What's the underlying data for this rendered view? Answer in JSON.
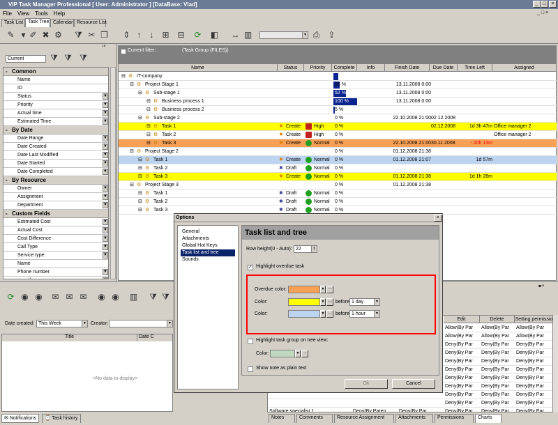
{
  "window": {
    "title": "VIP Task Manager Professional [ User: Administrator ] [DataBase: Vlad]"
  },
  "menu": [
    "File",
    "View",
    "Tools",
    "Help"
  ],
  "tabs": [
    "Task List",
    "Task Tree",
    "Calendar",
    "Resource List"
  ],
  "left_panel": {
    "filter_combo": "Current",
    "groups": [
      {
        "name": "Common",
        "items": [
          "Name",
          "ID",
          "Status",
          "Priority",
          "Actual time",
          "Estimated Time"
        ]
      },
      {
        "name": "By Date",
        "items": [
          "Date Range",
          "Date Created",
          "Date Last Modified",
          "Date Started",
          "Date Completed"
        ]
      },
      {
        "name": "By Resource",
        "items": [
          "Owner",
          "Assignment",
          "Department"
        ]
      },
      {
        "name": "Custom Fields",
        "items": [
          "Estimated Cost",
          "Actual Cost",
          "Cost Difference",
          "Call Type",
          "Service type",
          "Name",
          "Phone number",
          "e-mail"
        ]
      }
    ]
  },
  "filter_bar": {
    "label": "Current filter:",
    "value": "(Task Group  {FILES})"
  },
  "grid": {
    "columns": [
      "Name",
      "Status",
      "Priority",
      "Complete",
      "Info",
      "Finish Date",
      "Due Date",
      "Time Left",
      "Assigned"
    ],
    "rows": [
      {
        "name": "IT-company",
        "level": 0,
        "status": "",
        "priority": "",
        "complete": "",
        "finish": "",
        "due": "",
        "left": "",
        "assigned": "",
        "style": ""
      },
      {
        "name": "Project Stage 1",
        "level": 1,
        "status": "",
        "priority": "",
        "complete": "26 %",
        "finish": "13.11.2008 0:00",
        "due": "",
        "left": "",
        "assigned": "",
        "style": ""
      },
      {
        "name": "Sub-stage 1",
        "level": 2,
        "status": "",
        "priority": "",
        "complete": "52 %",
        "finish": "13.11.2008 0:00",
        "due": "",
        "left": "",
        "assigned": "",
        "style": ""
      },
      {
        "name": "Business process 1",
        "level": 3,
        "status": "",
        "priority": "",
        "complete": "100 %",
        "finish": "13.11.2008 0:00",
        "due": "",
        "left": "",
        "assigned": "",
        "style": ""
      },
      {
        "name": "Business process 2",
        "level": 3,
        "status": "",
        "priority": "",
        "complete": "5 %",
        "finish": "",
        "due": "",
        "left": "",
        "assigned": "",
        "style": ""
      },
      {
        "name": "Sub-stage 2",
        "level": 2,
        "status": "",
        "priority": "",
        "complete": "0 %",
        "finish": "22.10.2008 21:00",
        "due": "02.12.2008",
        "left": "",
        "assigned": "",
        "style": ""
      },
      {
        "name": "Task 1",
        "level": 3,
        "status": "Create",
        "priority": "High",
        "complete": "0 %",
        "finish": "",
        "due": "02.12.2008",
        "left": "1d 3h 47m",
        "assigned": "Office manager 2",
        "style": "yellow"
      },
      {
        "name": "Task 2",
        "level": 3,
        "status": "Create",
        "priority": "High",
        "complete": "0 %",
        "finish": "",
        "due": "",
        "left": "",
        "assigned": "Office manager 2",
        "style": ""
      },
      {
        "name": "Task 3",
        "level": 3,
        "status": "Create",
        "priority": "Normal",
        "complete": "0 %",
        "finish": "22.10.2008 21:00",
        "due": "30.11.2008",
        "left": "- 20h 13m",
        "assigned": "",
        "style": "orange"
      },
      {
        "name": "Project Stage 2",
        "level": 1,
        "status": "",
        "priority": "",
        "complete": "0 %",
        "finish": "01.12.2008 21:38",
        "due": "",
        "left": "",
        "assigned": "",
        "style": ""
      },
      {
        "name": "Task 1",
        "level": 2,
        "status": "Create",
        "priority": "Normal",
        "complete": "0 %",
        "finish": "01.12.2008 21:07",
        "due": "",
        "left": "1d 57m",
        "assigned": "",
        "style": "blue"
      },
      {
        "name": "Task 2",
        "level": 2,
        "status": "Draft",
        "priority": "Normal",
        "complete": "0 %",
        "finish": "",
        "due": "",
        "left": "",
        "assigned": "",
        "style": ""
      },
      {
        "name": "Task 3",
        "level": 2,
        "status": "Create",
        "priority": "Normal",
        "complete": "0 %",
        "finish": "01.12.2008 21:38",
        "due": "",
        "left": "1d 1h 28m",
        "assigned": "",
        "style": "yellow"
      },
      {
        "name": "Project Stage 3",
        "level": 1,
        "status": "",
        "priority": "",
        "complete": "0 %",
        "finish": "01.12.2008 21:38",
        "due": "",
        "left": "",
        "assigned": "",
        "style": ""
      },
      {
        "name": "Task 1",
        "level": 2,
        "status": "Draft",
        "priority": "Normal",
        "complete": "0 %",
        "finish": "",
        "due": "",
        "left": "",
        "assigned": "",
        "style": ""
      },
      {
        "name": "Task 2",
        "level": 2,
        "status": "Draft",
        "priority": "Normal",
        "complete": "0 %",
        "finish": "",
        "due": "",
        "left": "",
        "assigned": "",
        "style": ""
      },
      {
        "name": "Task 3",
        "level": 2,
        "status": "Draft",
        "priority": "Normal",
        "complete": "0 %",
        "finish": "",
        "due": "",
        "left": "",
        "assigned": "",
        "style": ""
      }
    ]
  },
  "completion_bars": [
    {
      "row": 0,
      "value": 0.2,
      "label": "20 %"
    },
    {
      "row": 1,
      "value": 0.26
    },
    {
      "row": 2,
      "value": 0.52
    },
    {
      "row": 3,
      "value": 1.0
    },
    {
      "row": 4,
      "value": 0.05
    }
  ],
  "bottom_left": {
    "date_created_label": "Date created:",
    "date_created_value": "This Week",
    "creator_label": "Creator:",
    "col_title": "Title",
    "col_date": "Date C",
    "empty": "<No data to display>",
    "tab_notifications": "Notifications",
    "tab_history": "Task history"
  },
  "bottom_right": {
    "columns": [
      "Edit",
      "Delete",
      "Setting permissio"
    ],
    "rows": [
      {
        "name": "",
        "edit": "Allow(By Par",
        "delete": "Allow(By Par",
        "setting": "Allow(By Par"
      },
      {
        "name": "",
        "edit": "Allow(By Par",
        "delete": "Allow(By Par",
        "setting": "Allow(By Par"
      },
      {
        "name": "",
        "edit": "Deny(By Par",
        "delete": "Deny(By Par",
        "setting": "Deny(By Par"
      },
      {
        "name": "",
        "edit": "Deny(By Par",
        "delete": "Deny(By Par",
        "setting": "Deny(By Par"
      },
      {
        "name": "",
        "edit": "Deny(By Par",
        "delete": "Deny(By Par",
        "setting": "Deny(By Par"
      },
      {
        "name": "",
        "edit": "Deny(By Par",
        "delete": "Deny(By Par",
        "setting": "Deny(By Par"
      },
      {
        "name": "",
        "edit": "Deny(By Par",
        "delete": "Deny(By Par",
        "setting": "Deny(By Par"
      },
      {
        "name": "",
        "edit": "Deny(By Par",
        "delete": "Deny(By Par",
        "setting": "Deny(By Par"
      },
      {
        "name": "",
        "edit": "Deny(By Par",
        "delete": "Deny(By Par",
        "setting": "Deny(By Par"
      },
      {
        "name": "",
        "edit": "Deny(By Par",
        "delete": "Deny(By Par",
        "setting": "Deny(By Par"
      },
      {
        "name": "Software specialist 1",
        "c1": "Deny(By Paren",
        "c2": "Deny(By Par",
        "edit": "Deny(By Par",
        "delete": "Deny(By Par",
        "setting": "Deny(By Par"
      },
      {
        "name": "Software specialist 2",
        "c1": "Deny(By Paren",
        "c2": "Deny(By Par",
        "edit": "Deny(By Par",
        "delete": "Deny(By Par",
        "setting": "Deny(By Par"
      }
    ],
    "tabs": [
      "Notes",
      "Comments",
      "Resource Assignment",
      "Attachments",
      "Permissions",
      "Charts"
    ]
  },
  "dialog": {
    "title": "Options",
    "nav": [
      "General",
      "Attachments",
      "Global Hot Keys",
      "Task list and tree",
      "Sounds"
    ],
    "selected_nav": 3,
    "heading": "Task list and tree",
    "row_height_label": "Row height(0 - Auto):",
    "row_height_value": "22",
    "highlight_overdue": "Highlight overdue task",
    "overdue_label": "Overdue color:",
    "color_label": "Color:",
    "before": "before",
    "before1": "1 day",
    "before2": "1 hour",
    "highlight_group": "Highlight task group on tree view:",
    "group_color_label": "Color:",
    "plain_text": "Show note as plain text",
    "ok": "Ok",
    "cancel": "Cancel",
    "colors": {
      "overdue": "#f7a056",
      "color1": "#ffff00",
      "color2": "#bdd4f0",
      "group": "#c0d8c0",
      "highlight_box": "#ff0000"
    }
  }
}
